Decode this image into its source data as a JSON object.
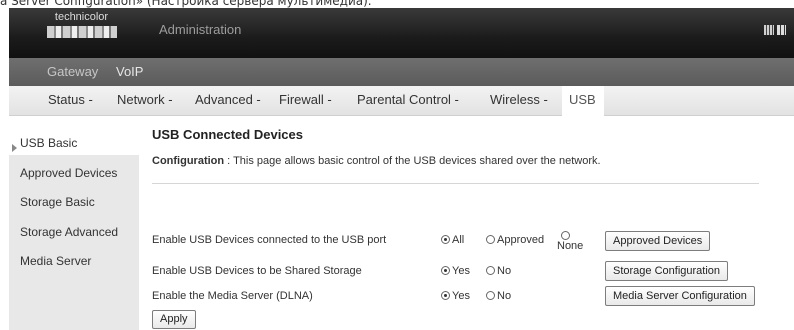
{
  "caption": "a Server Configuration» (Настройка сервера мультимедиа).",
  "header": {
    "logo_text": "technicolor",
    "title": "Administration"
  },
  "subnav": {
    "items": [
      "Gateway",
      "VoIP"
    ]
  },
  "mainnav": {
    "items": [
      "Status -",
      "Network -",
      "Advanced -",
      "Firewall -",
      "Parental Control -",
      "Wireless -",
      "USB"
    ],
    "active": "USB"
  },
  "sidebar": {
    "items": [
      "USB Basic",
      "Approved Devices",
      "Storage Basic",
      "Storage Advanced",
      "Media Server"
    ],
    "active": "USB Basic"
  },
  "page": {
    "heading": "USB Connected Devices",
    "config_label": "Configuration",
    "config_text": ":  This page allows basic control of the USB devices shared over the network."
  },
  "settings": [
    {
      "label": "Enable USB Devices connected to the USB port",
      "options": [
        "All",
        "Approved",
        "None"
      ],
      "selected": "All",
      "button": "Approved Devices"
    },
    {
      "label": "Enable USB Devices to be Shared Storage",
      "options": [
        "Yes",
        "No"
      ],
      "selected": "Yes",
      "button": "Storage Configuration"
    },
    {
      "label": "Enable the Media Server (DLNA)",
      "options": [
        "Yes",
        "No"
      ],
      "selected": "Yes",
      "button": "Media Server Configuration"
    }
  ],
  "apply_label": "Apply"
}
